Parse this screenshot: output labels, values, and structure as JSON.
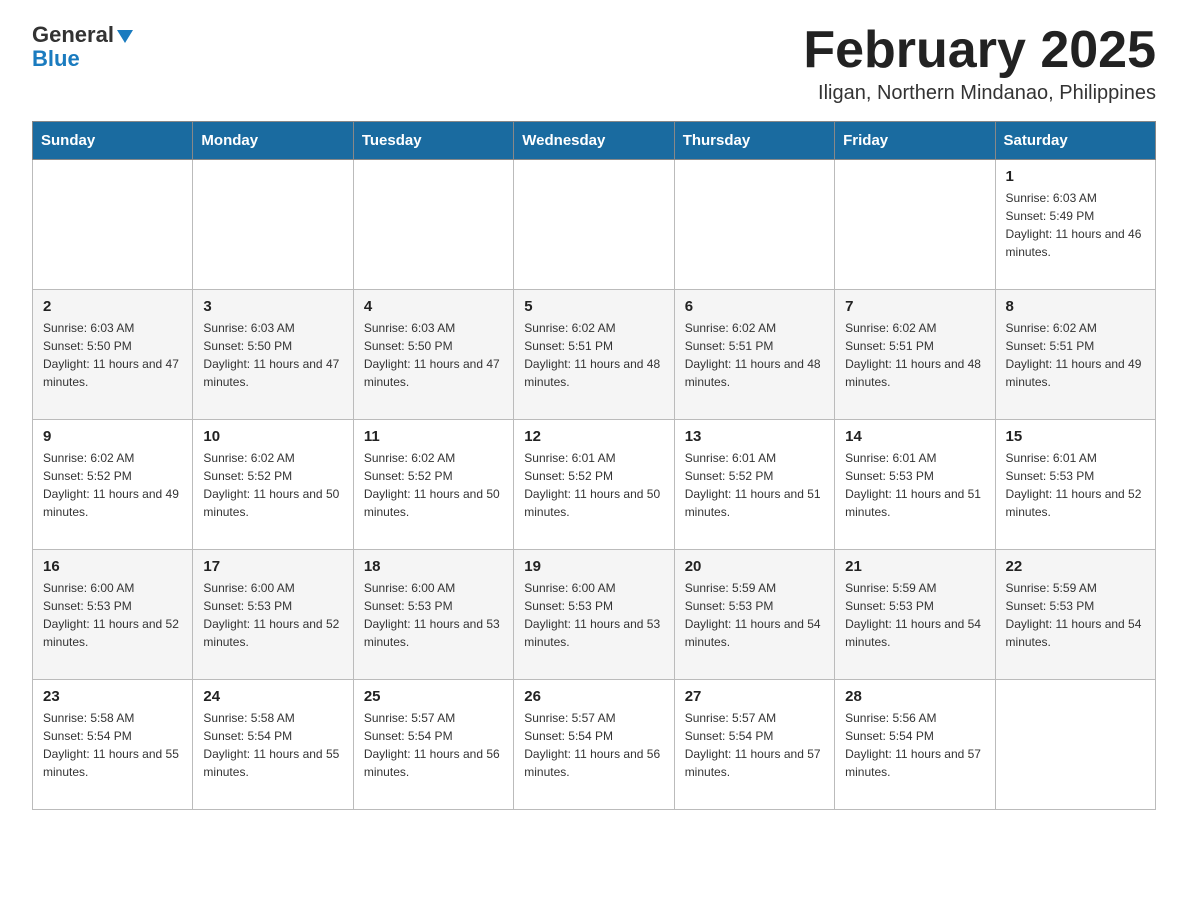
{
  "logo": {
    "general": "General",
    "triangle": "▼",
    "blue": "Blue"
  },
  "header": {
    "month_year": "February 2025",
    "location": "Iligan, Northern Mindanao, Philippines"
  },
  "weekdays": [
    "Sunday",
    "Monday",
    "Tuesday",
    "Wednesday",
    "Thursday",
    "Friday",
    "Saturday"
  ],
  "weeks": [
    {
      "class": "row-norm",
      "days": [
        {
          "num": "",
          "info": ""
        },
        {
          "num": "",
          "info": ""
        },
        {
          "num": "",
          "info": ""
        },
        {
          "num": "",
          "info": ""
        },
        {
          "num": "",
          "info": ""
        },
        {
          "num": "",
          "info": ""
        },
        {
          "num": "1",
          "info": "Sunrise: 6:03 AM\nSunset: 5:49 PM\nDaylight: 11 hours and 46 minutes."
        }
      ]
    },
    {
      "class": "row-alt",
      "days": [
        {
          "num": "2",
          "info": "Sunrise: 6:03 AM\nSunset: 5:50 PM\nDaylight: 11 hours and 47 minutes."
        },
        {
          "num": "3",
          "info": "Sunrise: 6:03 AM\nSunset: 5:50 PM\nDaylight: 11 hours and 47 minutes."
        },
        {
          "num": "4",
          "info": "Sunrise: 6:03 AM\nSunset: 5:50 PM\nDaylight: 11 hours and 47 minutes."
        },
        {
          "num": "5",
          "info": "Sunrise: 6:02 AM\nSunset: 5:51 PM\nDaylight: 11 hours and 48 minutes."
        },
        {
          "num": "6",
          "info": "Sunrise: 6:02 AM\nSunset: 5:51 PM\nDaylight: 11 hours and 48 minutes."
        },
        {
          "num": "7",
          "info": "Sunrise: 6:02 AM\nSunset: 5:51 PM\nDaylight: 11 hours and 48 minutes."
        },
        {
          "num": "8",
          "info": "Sunrise: 6:02 AM\nSunset: 5:51 PM\nDaylight: 11 hours and 49 minutes."
        }
      ]
    },
    {
      "class": "row-norm",
      "days": [
        {
          "num": "9",
          "info": "Sunrise: 6:02 AM\nSunset: 5:52 PM\nDaylight: 11 hours and 49 minutes."
        },
        {
          "num": "10",
          "info": "Sunrise: 6:02 AM\nSunset: 5:52 PM\nDaylight: 11 hours and 50 minutes."
        },
        {
          "num": "11",
          "info": "Sunrise: 6:02 AM\nSunset: 5:52 PM\nDaylight: 11 hours and 50 minutes."
        },
        {
          "num": "12",
          "info": "Sunrise: 6:01 AM\nSunset: 5:52 PM\nDaylight: 11 hours and 50 minutes."
        },
        {
          "num": "13",
          "info": "Sunrise: 6:01 AM\nSunset: 5:52 PM\nDaylight: 11 hours and 51 minutes."
        },
        {
          "num": "14",
          "info": "Sunrise: 6:01 AM\nSunset: 5:53 PM\nDaylight: 11 hours and 51 minutes."
        },
        {
          "num": "15",
          "info": "Sunrise: 6:01 AM\nSunset: 5:53 PM\nDaylight: 11 hours and 52 minutes."
        }
      ]
    },
    {
      "class": "row-alt",
      "days": [
        {
          "num": "16",
          "info": "Sunrise: 6:00 AM\nSunset: 5:53 PM\nDaylight: 11 hours and 52 minutes."
        },
        {
          "num": "17",
          "info": "Sunrise: 6:00 AM\nSunset: 5:53 PM\nDaylight: 11 hours and 52 minutes."
        },
        {
          "num": "18",
          "info": "Sunrise: 6:00 AM\nSunset: 5:53 PM\nDaylight: 11 hours and 53 minutes."
        },
        {
          "num": "19",
          "info": "Sunrise: 6:00 AM\nSunset: 5:53 PM\nDaylight: 11 hours and 53 minutes."
        },
        {
          "num": "20",
          "info": "Sunrise: 5:59 AM\nSunset: 5:53 PM\nDaylight: 11 hours and 54 minutes."
        },
        {
          "num": "21",
          "info": "Sunrise: 5:59 AM\nSunset: 5:53 PM\nDaylight: 11 hours and 54 minutes."
        },
        {
          "num": "22",
          "info": "Sunrise: 5:59 AM\nSunset: 5:53 PM\nDaylight: 11 hours and 54 minutes."
        }
      ]
    },
    {
      "class": "row-norm",
      "days": [
        {
          "num": "23",
          "info": "Sunrise: 5:58 AM\nSunset: 5:54 PM\nDaylight: 11 hours and 55 minutes."
        },
        {
          "num": "24",
          "info": "Sunrise: 5:58 AM\nSunset: 5:54 PM\nDaylight: 11 hours and 55 minutes."
        },
        {
          "num": "25",
          "info": "Sunrise: 5:57 AM\nSunset: 5:54 PM\nDaylight: 11 hours and 56 minutes."
        },
        {
          "num": "26",
          "info": "Sunrise: 5:57 AM\nSunset: 5:54 PM\nDaylight: 11 hours and 56 minutes."
        },
        {
          "num": "27",
          "info": "Sunrise: 5:57 AM\nSunset: 5:54 PM\nDaylight: 11 hours and 57 minutes."
        },
        {
          "num": "28",
          "info": "Sunrise: 5:56 AM\nSunset: 5:54 PM\nDaylight: 11 hours and 57 minutes."
        },
        {
          "num": "",
          "info": ""
        }
      ]
    }
  ]
}
